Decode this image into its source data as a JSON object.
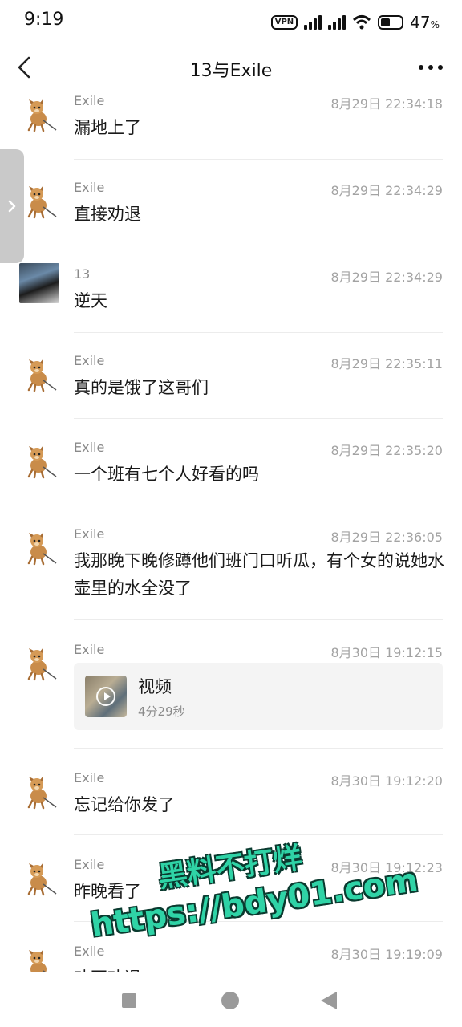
{
  "status_bar": {
    "time": "9:19",
    "vpn": "VPN",
    "battery": "47",
    "battery_unit": "%",
    "icons": [
      "vpn-icon",
      "signal-icon",
      "signal-icon",
      "wifi-icon",
      "battery-icon"
    ],
    "battery_level": 0.47
  },
  "header": {
    "title": "13与Exile",
    "back_icon": "chevron-left-icon",
    "more_icon": "more-dots-icon"
  },
  "side_tab": {
    "icon": "chevron-right-icon"
  },
  "messages": [
    {
      "sender": "Exile",
      "time": "8月29日 22:34:18",
      "text": "漏地上了",
      "avatar": "dog-sticker-avatar"
    },
    {
      "sender": "Exile",
      "time": "8月29日 22:34:29",
      "text": "直接劝退",
      "avatar": "dog-sticker-avatar"
    },
    {
      "sender": "13",
      "time": "8月29日 22:34:29",
      "text": "逆天",
      "avatar": "photo-avatar"
    },
    {
      "sender": "Exile",
      "time": "8月29日 22:35:11",
      "text": "真的是饿了这哥们",
      "avatar": "dog-sticker-avatar"
    },
    {
      "sender": "Exile",
      "time": "8月29日 22:35:20",
      "text": "一个班有七个人好看的吗",
      "avatar": "dog-sticker-avatar"
    },
    {
      "sender": "Exile",
      "time": "8月29日 22:36:05",
      "text": "我那晚下晚修蹲他们班门口听瓜，有个女的说她水壶里的水全没了",
      "avatar": "dog-sticker-avatar"
    },
    {
      "sender": "Exile",
      "time": "8月30日 19:12:15",
      "video_title": "视频",
      "video_duration": "4分29秒",
      "avatar": "dog-sticker-avatar"
    },
    {
      "sender": "Exile",
      "time": "8月30日 19:12:20",
      "text": "忘记给你发了",
      "avatar": "dog-sticker-avatar"
    },
    {
      "sender": "Exile",
      "time": "8月30日 19:12:23",
      "text": "昨晚看了",
      "avatar": "dog-sticker-avatar"
    },
    {
      "sender": "Exile",
      "time": "8月30日 19:19:09",
      "text": "劝不劝退",
      "avatar": "dog-sticker-avatar"
    }
  ],
  "watermark": {
    "line1": "黑料不打烊",
    "line2": "https://bdy01.com"
  },
  "navbar": {
    "icons": [
      "recent-apps-icon",
      "home-icon",
      "back-icon"
    ]
  },
  "colors": {
    "watermark": "#2fd3a6",
    "timestamp": "#a3a3a3",
    "sender": "#8a8a8a"
  }
}
